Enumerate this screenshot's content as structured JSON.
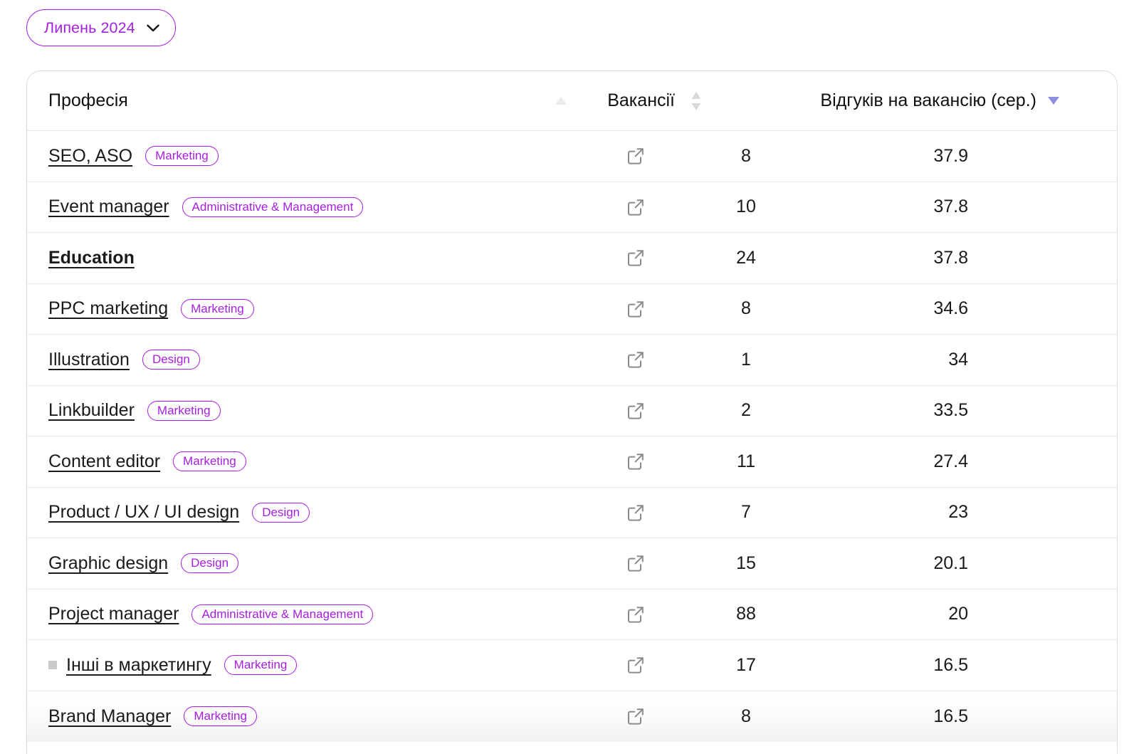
{
  "period_selector": {
    "label": "Липень 2024",
    "icon": "chevron-down-icon",
    "accent_color": "#a61fe0"
  },
  "table": {
    "columns": [
      {
        "key": "profession",
        "label": "Професія",
        "sort_state": "none",
        "sort_icon": "sort-ascending-icon"
      },
      {
        "key": "vacancies",
        "label": "Вакансії",
        "sort_state": "none",
        "sort_icon": "sort-both-icon"
      },
      {
        "key": "responses_avg",
        "label": "Відгуків на вакансію (сер.)",
        "sort_state": "descending",
        "sort_icon": "sort-descending-icon"
      }
    ],
    "link_icon": "external-link-icon",
    "rows": [
      {
        "name": "SEO, ASO",
        "tag": "Marketing",
        "bold": false,
        "bullet": false,
        "vacancies": "8",
        "responses_avg": "37.9"
      },
      {
        "name": "Event manager",
        "tag": "Administrative & Management",
        "bold": false,
        "bullet": false,
        "vacancies": "10",
        "responses_avg": "37.8"
      },
      {
        "name": "Education",
        "tag": "",
        "bold": true,
        "bullet": false,
        "vacancies": "24",
        "responses_avg": "37.8"
      },
      {
        "name": "PPC marketing",
        "tag": "Marketing",
        "bold": false,
        "bullet": false,
        "vacancies": "8",
        "responses_avg": "34.6"
      },
      {
        "name": "Illustration",
        "tag": "Design",
        "bold": false,
        "bullet": false,
        "vacancies": "1",
        "responses_avg": "34"
      },
      {
        "name": "Linkbuilder",
        "tag": "Marketing",
        "bold": false,
        "bullet": false,
        "vacancies": "2",
        "responses_avg": "33.5"
      },
      {
        "name": "Content editor",
        "tag": "Marketing",
        "bold": false,
        "bullet": false,
        "vacancies": "11",
        "responses_avg": "27.4"
      },
      {
        "name": "Product / UX / UI design",
        "tag": "Design",
        "bold": false,
        "bullet": false,
        "vacancies": "7",
        "responses_avg": "23"
      },
      {
        "name": "Graphic design",
        "tag": "Design",
        "bold": false,
        "bullet": false,
        "vacancies": "15",
        "responses_avg": "20.1"
      },
      {
        "name": "Project manager",
        "tag": "Administrative & Management",
        "bold": false,
        "bullet": false,
        "vacancies": "88",
        "responses_avg": "20"
      },
      {
        "name": "Інші в маркетингу",
        "tag": "Marketing",
        "bold": false,
        "bullet": true,
        "vacancies": "17",
        "responses_avg": "16.5"
      },
      {
        "name": "Brand Manager",
        "tag": "Marketing",
        "bold": false,
        "bullet": false,
        "vacancies": "8",
        "responses_avg": "16.5"
      }
    ]
  },
  "chart_data": {
    "type": "table",
    "title": "Професія",
    "categories": [
      "SEO, ASO",
      "Event manager",
      "Education",
      "PPC marketing",
      "Illustration",
      "Linkbuilder",
      "Content editor",
      "Product / UX / UI design",
      "Graphic design",
      "Project manager",
      "Інші в маркетингу",
      "Brand Manager"
    ],
    "series": [
      {
        "name": "Вакансії",
        "values": [
          8,
          10,
          24,
          8,
          1,
          2,
          11,
          7,
          15,
          88,
          17,
          8
        ]
      },
      {
        "name": "Відгуків на вакансію (сер.)",
        "values": [
          37.9,
          37.8,
          37.8,
          34.6,
          34,
          33.5,
          27.4,
          23,
          20.1,
          20,
          16.5,
          16.5
        ]
      }
    ],
    "sorted_by": "Відгуків на вакансію (сер.)",
    "sort_order": "descending",
    "period": "Липень 2024"
  }
}
